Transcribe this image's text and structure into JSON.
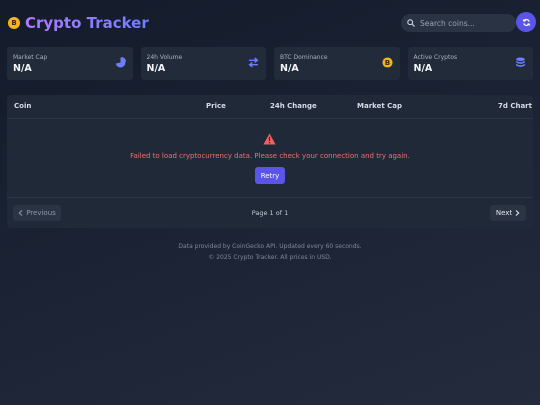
{
  "header": {
    "logo_glyph": "B",
    "title": "Crypto Tracker",
    "search_placeholder": "Search coins...",
    "accent_color": "#5b54e8",
    "icons": [
      "bitcoin-logo-icon",
      "search-icon",
      "refresh-icon"
    ]
  },
  "stats": [
    {
      "label": "Market Cap",
      "value": "N/A",
      "icon": "pie-chart-icon",
      "icon_color": "#6f7dff"
    },
    {
      "label": "24h Volume",
      "value": "N/A",
      "icon": "exchange-arrows-icon",
      "icon_color": "#6f7dff"
    },
    {
      "label": "BTC Dominance",
      "value": "N/A",
      "icon": "bitcoin-coin-icon",
      "icon_color": "#f5b51b"
    },
    {
      "label": "Active Cryptos",
      "value": "N/A",
      "icon": "coins-stack-icon",
      "icon_color": "#6f7dff"
    }
  ],
  "table": {
    "columns": [
      "Coin",
      "Price",
      "24h Change",
      "Market Cap",
      "7d Chart"
    ],
    "error_message": "Failed to load cryptocurrency data. Please check your connection and try again.",
    "error_color": "#f07070",
    "retry_label": "Retry"
  },
  "pagination": {
    "prev_label": "Previous",
    "page_info": "Page 1 of 1",
    "next_label": "Next"
  },
  "footer": {
    "line1": "Data provided by CoinGecko API. Updated every 60 seconds.",
    "line2": "© 2025 Crypto Tracker. All prices in USD."
  }
}
